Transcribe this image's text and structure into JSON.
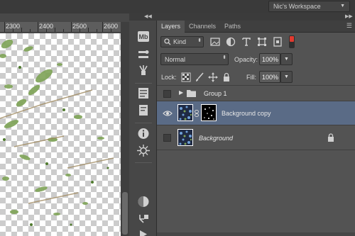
{
  "workspace": {
    "label": "Nic's Workspace"
  },
  "ruler": {
    "labels": [
      "2300",
      "2400",
      "2500",
      "2600"
    ]
  },
  "tabs": [
    "Layers",
    "Channels",
    "Paths"
  ],
  "filter": {
    "kind": "Kind"
  },
  "blend": {
    "mode": "Normal"
  },
  "opacity": {
    "label": "Opacity:",
    "value": "100%"
  },
  "lock": {
    "label": "Lock:"
  },
  "fill": {
    "label": "Fill:",
    "value": "100%"
  },
  "layers": [
    {
      "name": "Group 1",
      "type": "group",
      "visible": false,
      "selected": false
    },
    {
      "name": "Background copy",
      "type": "masked",
      "visible": true,
      "selected": true
    },
    {
      "name": "Background",
      "type": "background",
      "visible": false,
      "selected": false,
      "locked": true
    }
  ],
  "colors": {
    "selection": "#5a6b86",
    "panel": "#535353",
    "canvas_paint": "#7ea356"
  },
  "icons": {
    "toolstrip": [
      "mini-bridge-icon",
      "brush-presets-icon",
      "brushes-icon",
      "character-icon",
      "paragraph-icon",
      "info-icon",
      "navigator-icon",
      "color-icon",
      "history-icon",
      "actions-icon"
    ],
    "filters": [
      "image-filter-icon",
      "adjustment-filter-icon",
      "type-filter-icon",
      "shape-filter-icon",
      "smart-object-filter-icon",
      "filter-toggle-icon"
    ],
    "locks": [
      "lock-transparent-icon",
      "lock-image-icon",
      "lock-position-icon",
      "lock-all-icon"
    ]
  }
}
